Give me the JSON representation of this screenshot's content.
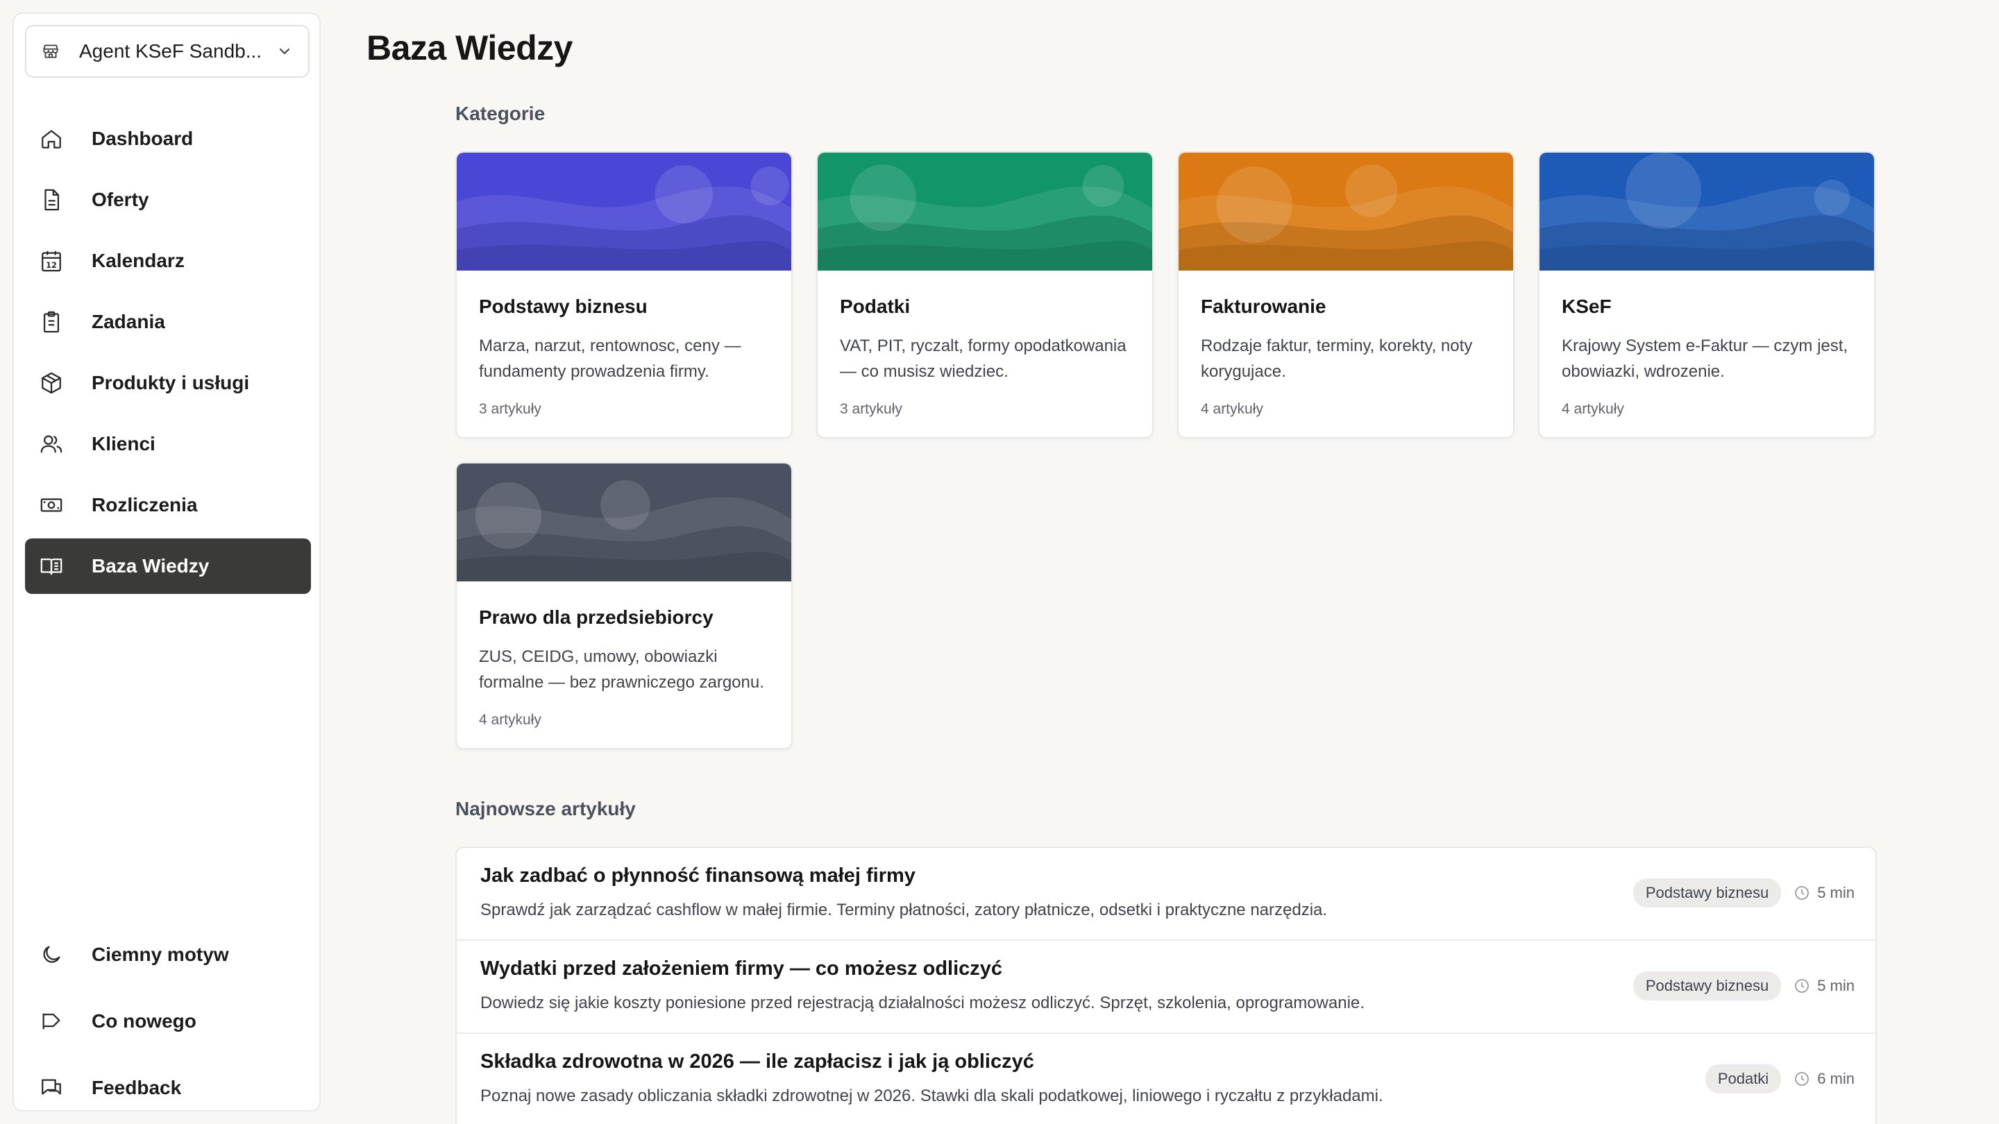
{
  "org": {
    "name": "Agent KSeF Sandb..."
  },
  "nav": {
    "items": [
      {
        "label": "Dashboard",
        "icon": "home-icon"
      },
      {
        "label": "Oferty",
        "icon": "document-icon"
      },
      {
        "label": "Kalendarz",
        "icon": "calendar-icon",
        "icon_text": "12"
      },
      {
        "label": "Zadania",
        "icon": "clipboard-icon"
      },
      {
        "label": "Produkty i usługi",
        "icon": "box-icon"
      },
      {
        "label": "Klienci",
        "icon": "users-icon"
      },
      {
        "label": "Rozliczenia",
        "icon": "money-icon"
      },
      {
        "label": "Baza Wiedzy",
        "icon": "book-icon",
        "active": true
      }
    ],
    "bottom": [
      {
        "label": "Ciemny motyw",
        "icon": "moon-icon"
      },
      {
        "label": "Co nowego",
        "icon": "megaphone-icon"
      },
      {
        "label": "Feedback",
        "icon": "chat-icon"
      }
    ]
  },
  "page": {
    "title": "Baza Wiedzy"
  },
  "categories_section": {
    "title": "Kategorie"
  },
  "categories": [
    {
      "title": "Podstawy biznesu",
      "desc": "Marza, narzut, rentownosc, ceny — fundamenty prowadzenia firmy.",
      "count": "3 artykuły",
      "color": "#4a47d6"
    },
    {
      "title": "Podatki",
      "desc": "VAT, PIT, ryczalt, formy opodatkowania — co musisz wiedziec.",
      "count": "3 artykuły",
      "color": "#13956a"
    },
    {
      "title": "Fakturowanie",
      "desc": "Rodzaje faktur, terminy, korekty, noty korygujace.",
      "count": "4 artykuły",
      "color": "#db7a12"
    },
    {
      "title": "KSeF",
      "desc": "Krajowy System e-Faktur — czym jest, obowiazki, wdrozenie.",
      "count": "4 artykuły",
      "color": "#1e5bb8"
    },
    {
      "title": "Prawo dla przedsiebiorcy",
      "desc": "ZUS, CEIDG, umowy, obowiazki formalne — bez prawniczego zargonu.",
      "count": "4 artykuły",
      "color": "#4a5160"
    }
  ],
  "latest_section": {
    "title": "Najnowsze artykuły"
  },
  "articles": [
    {
      "title": "Jak zadbać o płynność finansową małej firmy",
      "desc": "Sprawdź jak zarządzać cashflow w małej firmie. Terminy płatności, zatory płatnicze, odsetki i praktyczne narzędzia.",
      "tag": "Podstawy biznesu",
      "time": "5 min"
    },
    {
      "title": "Wydatki przed założeniem firmy — co możesz odliczyć",
      "desc": "Dowiedz się jakie koszty poniesione przed rejestracją działalności możesz odliczyć. Sprzęt, szkolenia, oprogramowanie.",
      "tag": "Podstawy biznesu",
      "time": "5 min"
    },
    {
      "title": "Składka zdrowotna w 2026 — ile zapłacisz i jak ją obliczyć",
      "desc": "Poznaj nowe zasady obliczania składki zdrowotnej w 2026. Stawki dla skali podatkowej, liniowego i ryczałtu z przykładami.",
      "tag": "Podatki",
      "time": "6 min"
    }
  ]
}
